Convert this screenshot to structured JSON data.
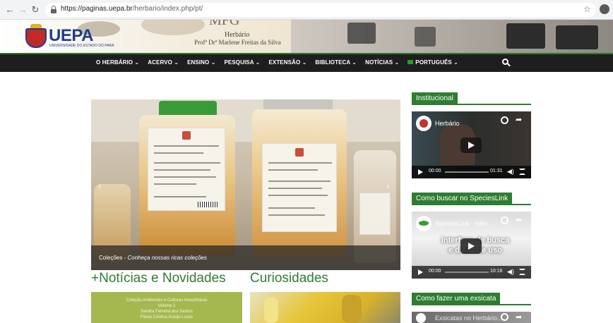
{
  "browser": {
    "url_host": "https://paginas.uepa.br",
    "url_path": "/herbario/index.php/pt/"
  },
  "header": {
    "brand": "UEPA",
    "brand_sub": "UNIVERSIDADE DO ESTADO DO PARÁ",
    "mp": "MFG",
    "herbario": "Herbário",
    "herbario_sub": "Profª Drª Marlene Freitas da Silva"
  },
  "nav": {
    "items": [
      "O HERBÁRIO ⌄",
      "ACERVO ⌄",
      "ENSINO ⌄",
      "PESQUISA ⌄",
      "EXTENSÃO ⌄",
      "BIBLIOTECA ⌄",
      "NOTÍCIAS ⌄"
    ],
    "language": "PORTUGUÊS ⌄"
  },
  "slider": {
    "caption_label": "Coleções - ",
    "caption_text": "Conheça nossas ricas coleções"
  },
  "sections": {
    "news": "+Notícias e Novidades",
    "curiosities": "Curiosidades"
  },
  "news_thumb": {
    "line1": "Coleção Ambientes e Culturas Amazônicas",
    "line2": "Volume 1",
    "line3": "Sandra Ferreira dos Santos",
    "line4": "Flávia Cristina Araújo Lucas"
  },
  "sidebar": {
    "widgets": [
      {
        "title": "Institucional",
        "video_title": "Herbário",
        "time_start": "00:00",
        "time_end": "01:31"
      },
      {
        "title": "Como buscar no SpeciesLink",
        "video_title": "SpeciesLink - Inter...",
        "overlay": "Interface de busca e dicas de uso",
        "time_start": "00:00",
        "time_end": "10:16"
      },
      {
        "title": "Como fazer uma exsicata",
        "video_title": "Exsicatas no Herbário..."
      }
    ]
  },
  "colors": {
    "accent_green": "#2f7d32",
    "nav_bg": "#1e1e1e",
    "brand_blue": "#1e3e8a"
  }
}
